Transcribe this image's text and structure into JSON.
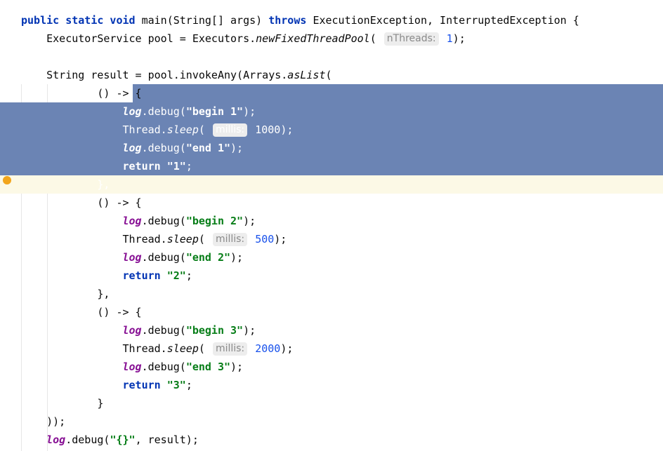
{
  "editor": {
    "lines": [
      {
        "segments": [
          {
            "t": "public static void ",
            "c": "kw"
          },
          {
            "t": "main(String[] args) ",
            "c": ""
          },
          {
            "t": "throws ",
            "c": "kw"
          },
          {
            "t": "ExecutionException, InterruptedException {",
            "c": ""
          }
        ]
      },
      {
        "segments": [
          {
            "t": "    ExecutorService pool = Executors.",
            "c": ""
          },
          {
            "t": "newFixedThreadPool",
            "c": "ital"
          },
          {
            "t": "( ",
            "c": ""
          },
          {
            "t": "nThreads:",
            "c": "hint"
          },
          {
            "t": " ",
            "c": ""
          },
          {
            "t": "1",
            "c": "num"
          },
          {
            "t": ");",
            "c": ""
          }
        ]
      },
      {
        "segments": []
      },
      {
        "segments": [
          {
            "t": "    String result = pool.invokeAny(Arrays.",
            "c": ""
          },
          {
            "t": "asList",
            "c": "ital"
          },
          {
            "t": "(",
            "c": ""
          }
        ]
      },
      {
        "segments": [
          {
            "t": "            () -> {",
            "c": ""
          }
        ]
      },
      {
        "segments": [
          {
            "t": "                ",
            "c": ""
          },
          {
            "t": "log",
            "c": "logv"
          },
          {
            "t": ".debug(",
            "c": ""
          },
          {
            "t": "\"begin 1\"",
            "c": "str"
          },
          {
            "t": ");",
            "c": ""
          }
        ]
      },
      {
        "segments": [
          {
            "t": "                Thread.",
            "c": ""
          },
          {
            "t": "sleep",
            "c": "ital"
          },
          {
            "t": "( ",
            "c": ""
          },
          {
            "t": "millis:",
            "c": "hint"
          },
          {
            "t": " ",
            "c": ""
          },
          {
            "t": "1000",
            "c": "num"
          },
          {
            "t": ");",
            "c": ""
          }
        ]
      },
      {
        "segments": [
          {
            "t": "                ",
            "c": ""
          },
          {
            "t": "log",
            "c": "logv"
          },
          {
            "t": ".debug(",
            "c": ""
          },
          {
            "t": "\"end 1\"",
            "c": "str"
          },
          {
            "t": ");",
            "c": ""
          }
        ]
      },
      {
        "segments": [
          {
            "t": "                ",
            "c": ""
          },
          {
            "t": "return ",
            "c": "kw"
          },
          {
            "t": "\"1\"",
            "c": "str"
          },
          {
            "t": ";",
            "c": ""
          }
        ]
      },
      {
        "segments": [
          {
            "t": "            },",
            "c": ""
          }
        ]
      },
      {
        "segments": [
          {
            "t": "            () -> {",
            "c": ""
          }
        ]
      },
      {
        "segments": [
          {
            "t": "                ",
            "c": ""
          },
          {
            "t": "log",
            "c": "logv"
          },
          {
            "t": ".debug(",
            "c": ""
          },
          {
            "t": "\"begin 2\"",
            "c": "str"
          },
          {
            "t": ");",
            "c": ""
          }
        ]
      },
      {
        "segments": [
          {
            "t": "                Thread.",
            "c": ""
          },
          {
            "t": "sleep",
            "c": "ital"
          },
          {
            "t": "( ",
            "c": ""
          },
          {
            "t": "millis:",
            "c": "hint"
          },
          {
            "t": " ",
            "c": ""
          },
          {
            "t": "500",
            "c": "num"
          },
          {
            "t": ");",
            "c": ""
          }
        ]
      },
      {
        "segments": [
          {
            "t": "                ",
            "c": ""
          },
          {
            "t": "log",
            "c": "logv"
          },
          {
            "t": ".debug(",
            "c": ""
          },
          {
            "t": "\"end 2\"",
            "c": "str"
          },
          {
            "t": ");",
            "c": ""
          }
        ]
      },
      {
        "segments": [
          {
            "t": "                ",
            "c": ""
          },
          {
            "t": "return ",
            "c": "kw"
          },
          {
            "t": "\"2\"",
            "c": "str"
          },
          {
            "t": ";",
            "c": ""
          }
        ]
      },
      {
        "segments": [
          {
            "t": "            },",
            "c": ""
          }
        ]
      },
      {
        "segments": [
          {
            "t": "            () -> {",
            "c": ""
          }
        ]
      },
      {
        "segments": [
          {
            "t": "                ",
            "c": ""
          },
          {
            "t": "log",
            "c": "logv"
          },
          {
            "t": ".debug(",
            "c": ""
          },
          {
            "t": "\"begin 3\"",
            "c": "str"
          },
          {
            "t": ");",
            "c": ""
          }
        ]
      },
      {
        "segments": [
          {
            "t": "                Thread.",
            "c": ""
          },
          {
            "t": "sleep",
            "c": "ital"
          },
          {
            "t": "( ",
            "c": ""
          },
          {
            "t": "millis:",
            "c": "hint"
          },
          {
            "t": " ",
            "c": ""
          },
          {
            "t": "2000",
            "c": "num"
          },
          {
            "t": ");",
            "c": ""
          }
        ]
      },
      {
        "segments": [
          {
            "t": "                ",
            "c": ""
          },
          {
            "t": "log",
            "c": "logv"
          },
          {
            "t": ".debug(",
            "c": ""
          },
          {
            "t": "\"end 3\"",
            "c": "str"
          },
          {
            "t": ");",
            "c": ""
          }
        ]
      },
      {
        "segments": [
          {
            "t": "                ",
            "c": ""
          },
          {
            "t": "return ",
            "c": "kw"
          },
          {
            "t": "\"3\"",
            "c": "str"
          },
          {
            "t": ";",
            "c": ""
          }
        ]
      },
      {
        "segments": [
          {
            "t": "            }",
            "c": ""
          }
        ]
      },
      {
        "segments": [
          {
            "t": "    ));",
            "c": ""
          }
        ]
      },
      {
        "segments": [
          {
            "t": "    ",
            "c": ""
          },
          {
            "t": "log",
            "c": "logv"
          },
          {
            "t": ".debug(",
            "c": ""
          },
          {
            "t": "\"{}\"",
            "c": "str"
          },
          {
            "t": ", result);",
            "c": ""
          }
        ]
      }
    ],
    "current_line": 9,
    "breakpoint_line": 9,
    "selection": {
      "from_line": 4,
      "to_line": 9
    },
    "colors": {
      "keyword": "#0033b3",
      "string": "#067d17",
      "number": "#1750eb",
      "static_field": "#871094",
      "selection": "#6b84b4",
      "current_line": "#fcf9e6",
      "breakpoint": "#f2a51b"
    }
  }
}
